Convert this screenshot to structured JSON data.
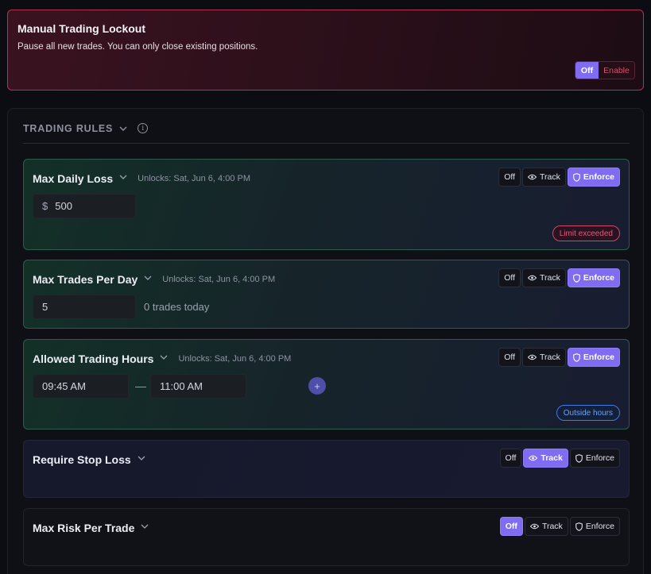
{
  "lockout": {
    "title": "Manual Trading Lockout",
    "description": "Pause all new trades. You can only close existing positions.",
    "toggle": {
      "off_label": "Off",
      "enable_label": "Enable",
      "selected": "Off"
    }
  },
  "rules_panel": {
    "title": "TRADING RULES"
  },
  "mode_labels": {
    "off": "Off",
    "track": "Track",
    "enforce": "Enforce"
  },
  "rules": [
    {
      "name": "Max Daily Loss",
      "unlocks": "Unlocks: Sat, Jun 6, 4:00 PM",
      "mode": "Enforce",
      "currency": "$",
      "value": "500",
      "status": "Limit exceeded"
    },
    {
      "name": "Max Trades Per Day",
      "unlocks": "Unlocks: Sat, Jun 6, 4:00 PM",
      "mode": "Enforce",
      "value": "5",
      "hint": "0 trades today"
    },
    {
      "name": "Allowed Trading Hours",
      "unlocks": "Unlocks: Sat, Jun 6, 4:00 PM",
      "mode": "Enforce",
      "start": "09:45 AM",
      "separator": "—",
      "end": "11:00 AM",
      "add_symbol": "+",
      "status": "Outside hours"
    },
    {
      "name": "Require Stop Loss",
      "mode": "Track"
    },
    {
      "name": "Max Risk Per Trade",
      "mode": "Off"
    }
  ],
  "colors": {
    "accent": "#7f6cf0",
    "danger": "#e2496d",
    "info": "#6ea1f2"
  }
}
